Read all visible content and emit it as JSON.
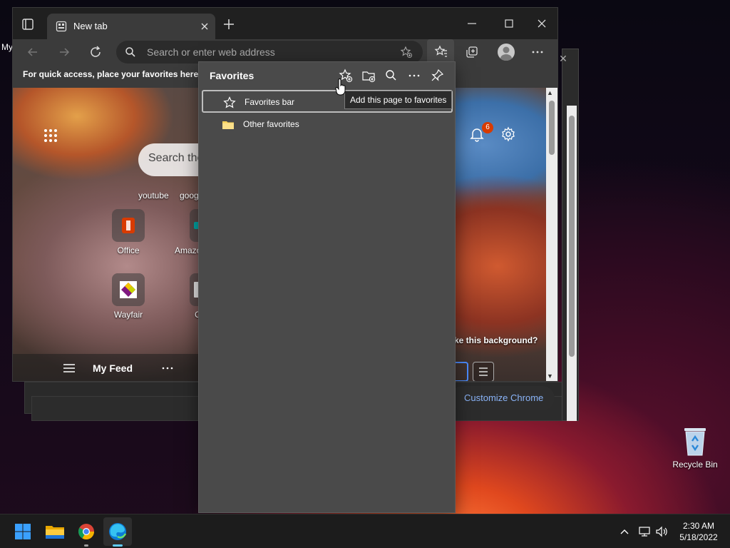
{
  "desktop": {
    "left_label": "My",
    "recycle_bin_label": "Recycle Bin"
  },
  "chrome_window": {
    "customize_label": "Customize Chrome"
  },
  "edge": {
    "tab_title": "New tab",
    "address_placeholder": "Search or enter web address",
    "favorites_bar_prompt": "For quick access, place your favorites here on",
    "newtab": {
      "search_placeholder": "Search the",
      "links": [
        "youtube",
        "goog"
      ],
      "tiles": [
        "Office",
        "Amazo",
        "Wayfair",
        "C"
      ],
      "notification_count": "6",
      "background_prompt": "ke this background?",
      "feed_label": "My Feed"
    }
  },
  "favorites": {
    "title": "Favorites",
    "items": [
      {
        "label": "Favorites bar",
        "icon": "star-icon",
        "selected": true
      },
      {
        "label": "Other favorites",
        "icon": "folder-icon",
        "selected": false
      }
    ],
    "tooltip": "Add this page to favorites"
  },
  "taskbar": {
    "apps": [
      "start-icon",
      "file-explorer-icon",
      "chrome-icon",
      "edge-icon"
    ],
    "time": "2:30 AM",
    "date": "5/18/2022"
  },
  "colors": {
    "accent": "#60cdff",
    "badge": "#d83b01",
    "flyout_bg": "#4a4a4a",
    "folder": "#f8d15a"
  }
}
